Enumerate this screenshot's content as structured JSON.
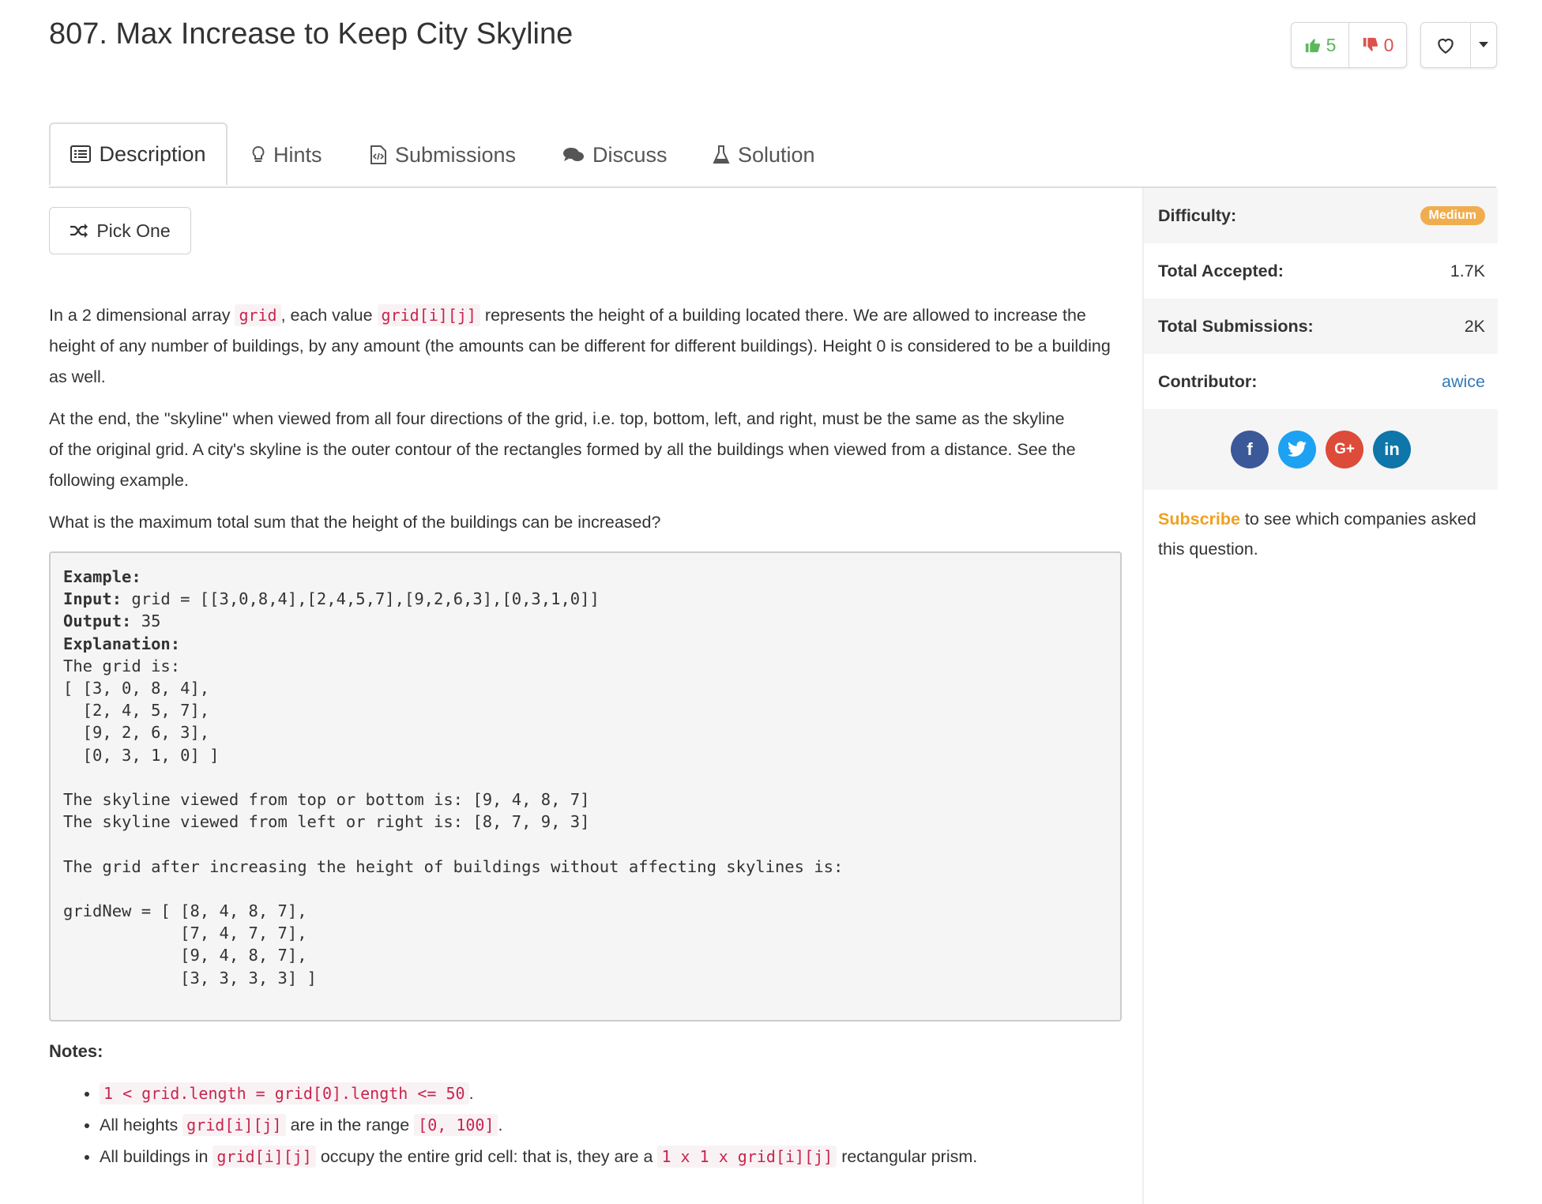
{
  "problem": {
    "title": "807. Max Increase to Keep City Skyline",
    "upvotes": "5",
    "downvotes": "0"
  },
  "tabs": [
    {
      "label": "Description",
      "icon": "list-icon"
    },
    {
      "label": "Hints",
      "icon": "lightbulb-icon"
    },
    {
      "label": "Submissions",
      "icon": "code-file-icon"
    },
    {
      "label": "Discuss",
      "icon": "chat-bubbles-icon"
    },
    {
      "label": "Solution",
      "icon": "flask-icon"
    }
  ],
  "pick_one": {
    "label": "Pick One",
    "icon": "shuffle-icon"
  },
  "description": {
    "p1": [
      "In a 2 dimensional array ",
      "grid",
      ", each value ",
      "grid[i][j]",
      " represents the height of a building located there. We are allowed to increase the height of any number of buildings, by any amount (the amounts can be different for different buildings). Height 0 is considered to be a building as well."
    ],
    "p2": "At the end, the \"skyline\" when viewed from all four directions of the grid, i.e. top, bottom, left, and right, must be the same as the skyline of the original grid. A city's skyline is the outer contour of the rectangles formed by all the buildings when viewed from a distance. See the following example.",
    "p3": "What is the maximum total sum that the height of the buildings can be increased?"
  },
  "example": {
    "example_label": "Example:",
    "input_label": "Input:",
    "input_value": " grid = [[3,0,8,4],[2,4,5,7],[9,2,6,3],[0,3,1,0]]",
    "output_label": "Output:",
    "output_value": " 35",
    "explanation_label": "Explanation:",
    "body": "The grid is:\n[ [3, 0, 8, 4], \n  [2, 4, 5, 7],\n  [9, 2, 6, 3],\n  [0, 3, 1, 0] ]\n\nThe skyline viewed from top or bottom is: [9, 4, 8, 7]\nThe skyline viewed from left or right is: [8, 7, 9, 3]\n\nThe grid after increasing the height of buildings without affecting skylines is:\n\ngridNew = [ [8, 4, 8, 7],\n            [7, 4, 7, 7],\n            [9, 4, 8, 7],\n            [3, 3, 3, 3] ]"
  },
  "notes": {
    "title": "Notes:",
    "item1_code": "1 < grid.length = grid[0].length <= 50",
    "item1_end": ".",
    "item2_a": "All heights ",
    "item2_code1": "grid[i][j]",
    "item2_b": " are in the range ",
    "item2_code2": "[0, 100]",
    "item2_end": ".",
    "item3_a": "All buildings in ",
    "item3_code1": "grid[i][j]",
    "item3_b": " occupy the entire grid cell: that is, they are a ",
    "item3_code2": "1 x 1 x grid[i][j]",
    "item3_c": " rectangular prism."
  },
  "sidebar": {
    "difficulty_label": "Difficulty:",
    "difficulty_value": "Medium",
    "accepted_label": "Total Accepted:",
    "accepted_value": "1.7K",
    "submissions_label": "Total Submissions:",
    "submissions_value": "2K",
    "contributor_label": "Contributor:",
    "contributor_value": "awice",
    "social": [
      "facebook-icon",
      "twitter-icon",
      "google-plus-icon",
      "linkedin-icon"
    ],
    "subscribe_link": "Subscribe",
    "subscribe_text": " to see which companies asked this question."
  },
  "colors": {
    "accent_blue": "#337ab7",
    "medium_badge": "#f0ad4e",
    "code_red": "#c7254e",
    "upvote_green": "#5cb85c",
    "downvote_red": "#d9534f"
  }
}
